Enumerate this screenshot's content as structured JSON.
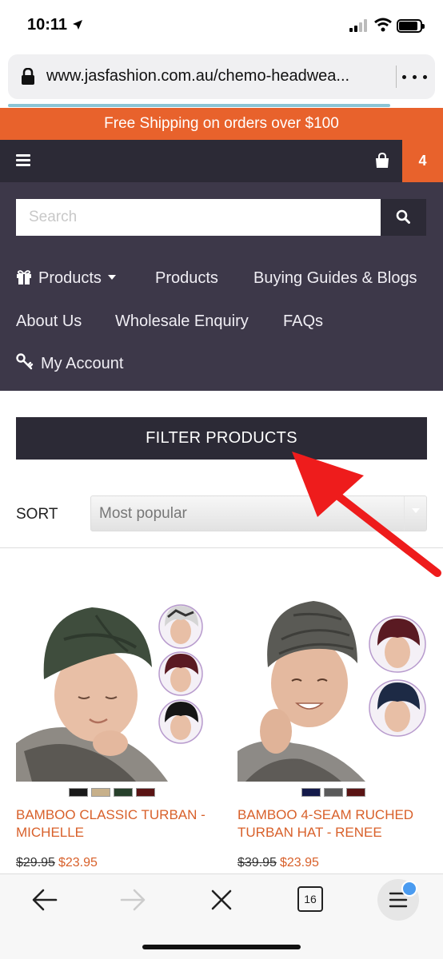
{
  "status_bar": {
    "time": "10:11"
  },
  "browser": {
    "url": "www.jasfashion.com.au/chemo-headwea...",
    "tab_count": "16"
  },
  "promo": {
    "text": "Free Shipping on orders over $100"
  },
  "header": {
    "cart_count": "4"
  },
  "search": {
    "placeholder": "Search"
  },
  "nav": {
    "products_dropdown": "Products",
    "products": "Products",
    "guides": "Buying Guides & Blogs",
    "about": "About Us",
    "wholesale": "Wholesale Enquiry",
    "faqs": "FAQs",
    "account": "My Account"
  },
  "filter": {
    "button_label": "FILTER PRODUCTS"
  },
  "sort": {
    "label": "SORT",
    "value": "Most popular"
  },
  "products": [
    {
      "name": "BAMBOO CLASSIC TURBAN - MICHELLE",
      "price_old": "$29.95",
      "price_new": "$23.95",
      "swatches": [
        "#1a1a1a",
        "#c7b08a",
        "#27402b",
        "#5a1414"
      ]
    },
    {
      "name": "BAMBOO 4-SEAM RUCHED TURBAN HAT - RENEE",
      "price_old": "$39.95",
      "price_new": "$23.95",
      "swatches": [
        "#141a4a",
        "#5a5a5a",
        "#5a1414"
      ]
    }
  ],
  "colors": {
    "accent": "#e8622c",
    "header_dark": "#2c2a36",
    "nav_bg": "#3d3849",
    "product_title": "#d8602a",
    "annotation_arrow": "#ee1c1c"
  },
  "icons": [
    "location-arrow-icon",
    "signal-icon",
    "wifi-icon",
    "battery-icon",
    "lock-icon",
    "more-icon",
    "menu-icon",
    "cart-icon",
    "search-icon",
    "gift-icon",
    "key-icon",
    "back-icon",
    "forward-icon",
    "close-icon",
    "tabs-icon",
    "browser-menu-icon"
  ]
}
